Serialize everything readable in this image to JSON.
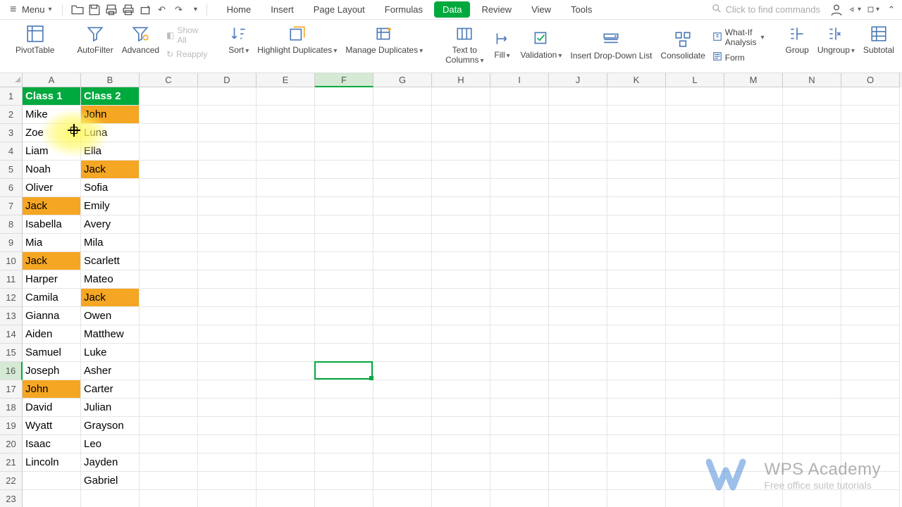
{
  "menu": {
    "label": "Menu"
  },
  "tabs": [
    "Home",
    "Insert",
    "Page Layout",
    "Formulas",
    "Data",
    "Review",
    "View",
    "Tools"
  ],
  "active_tab": 4,
  "search_placeholder": "Click to find commands",
  "ribbon": {
    "pivottable": "PivotTable",
    "autofilter": "AutoFilter",
    "advanced": "Advanced",
    "showall": "Show All",
    "reapply": "Reapply",
    "sort": "Sort",
    "highlight_dup": "Highlight Duplicates",
    "manage_dup": "Manage Duplicates",
    "text_to_columns": "Text to Columns",
    "fill": "Fill",
    "validation": "Validation",
    "insert_dropdown": "Insert Drop-Down List",
    "consolidate": "Consolidate",
    "whatif": "What-If Analysis",
    "form": "Form",
    "group": "Group",
    "ungroup": "Ungroup",
    "subtotal": "Subtotal"
  },
  "columns": [
    "A",
    "B",
    "C",
    "D",
    "E",
    "F",
    "G",
    "H",
    "I",
    "J",
    "K",
    "L",
    "M",
    "N",
    "O"
  ],
  "rows": [
    1,
    2,
    3,
    4,
    5,
    6,
    7,
    8,
    9,
    10,
    11,
    12,
    13,
    14,
    15,
    16,
    17,
    18,
    19,
    20,
    21,
    22,
    23
  ],
  "selected_col": "F",
  "selected_row": 16,
  "grid": {
    "A1": {
      "v": "Class 1",
      "hdr": true
    },
    "B1": {
      "v": "Class 2",
      "hdr": true
    },
    "A2": {
      "v": "Mike"
    },
    "B2": {
      "v": "John",
      "hl": true
    },
    "A3": {
      "v": "Zoe"
    },
    "B3": {
      "v": "Luna"
    },
    "A4": {
      "v": "Liam"
    },
    "B4": {
      "v": "Ella"
    },
    "A5": {
      "v": "Noah"
    },
    "B5": {
      "v": "Jack",
      "hl": true
    },
    "A6": {
      "v": "Oliver"
    },
    "B6": {
      "v": "Sofia"
    },
    "A7": {
      "v": "Jack",
      "hl": true
    },
    "B7": {
      "v": "Emily"
    },
    "A8": {
      "v": "Isabella"
    },
    "B8": {
      "v": "Avery"
    },
    "A9": {
      "v": "Mia"
    },
    "B9": {
      "v": "Mila"
    },
    "A10": {
      "v": "Jack",
      "hl": true
    },
    "B10": {
      "v": "Scarlett"
    },
    "A11": {
      "v": "Harper"
    },
    "B11": {
      "v": "Mateo"
    },
    "A12": {
      "v": "Camila"
    },
    "B12": {
      "v": "Jack",
      "hl": true
    },
    "A13": {
      "v": "Gianna"
    },
    "B13": {
      "v": "Owen"
    },
    "A14": {
      "v": "Aiden"
    },
    "B14": {
      "v": "Matthew"
    },
    "A15": {
      "v": "Samuel"
    },
    "B15": {
      "v": "Luke"
    },
    "A16": {
      "v": "Joseph"
    },
    "B16": {
      "v": "Asher"
    },
    "A17": {
      "v": "John",
      "hl": true
    },
    "B17": {
      "v": "Carter"
    },
    "A18": {
      "v": "David"
    },
    "B18": {
      "v": "Julian"
    },
    "A19": {
      "v": "Wyatt"
    },
    "B19": {
      "v": "Grayson"
    },
    "A20": {
      "v": "Isaac"
    },
    "B20": {
      "v": "Leo"
    },
    "A21": {
      "v": "Lincoln"
    },
    "B21": {
      "v": "Jayden"
    },
    "B22": {
      "v": "Gabriel"
    }
  },
  "watermark": {
    "title": "WPS Academy",
    "subtitle": "Free office suite tutorials"
  }
}
